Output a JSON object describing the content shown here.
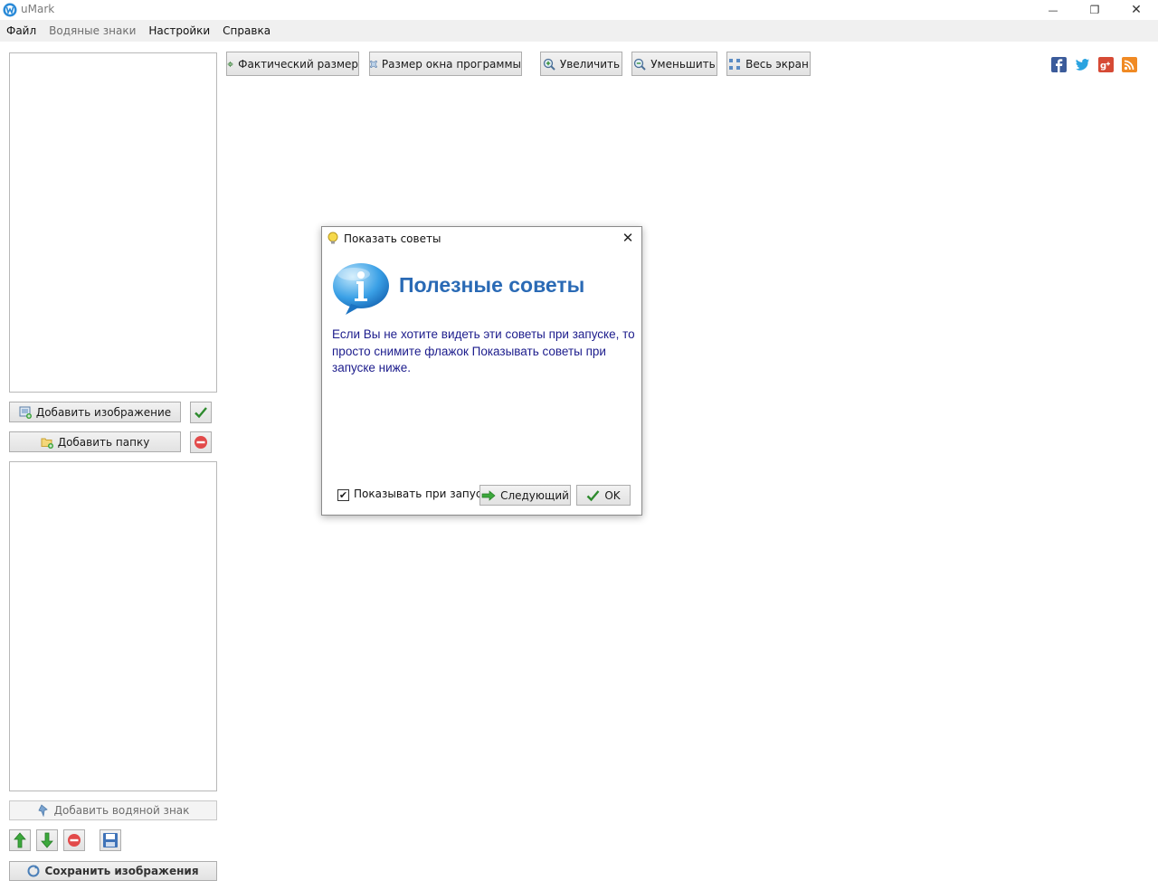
{
  "window": {
    "title": "uMark",
    "minimize_glyph": "—",
    "restore_glyph": "❐",
    "close_glyph": "✕"
  },
  "menu": [
    {
      "label": "Файл",
      "enabled": true
    },
    {
      "label": "Водяные знаки",
      "enabled": false
    },
    {
      "label": "Настройки",
      "enabled": true
    },
    {
      "label": "Справка",
      "enabled": true
    }
  ],
  "left_panel": {
    "add_image_label": "Добавить изображение",
    "add_folder_label": "Добавить папку",
    "add_watermark_label": "Добавить водяной знак",
    "save_images_label": "Сохранить изображения"
  },
  "toolbar": {
    "actual_size": "Фактический размер",
    "window_size": "Размер окна программы",
    "zoom_in": "Увеличить",
    "zoom_out": "Уменьшить",
    "full_screen": "Весь экран"
  },
  "social": [
    "facebook-icon",
    "twitter-icon",
    "google-plus-icon",
    "rss-icon"
  ],
  "dialog": {
    "title": "Показать советы",
    "heading": "Полезные советы",
    "text": "Если Вы не хотите видеть эти советы при запуске, то просто снимите флажок Показывать советы при запуске ниже.",
    "checkbox_label": "Показывать при запуске",
    "checkbox_checked": true,
    "next_label": "Следующий",
    "ok_label": "OK",
    "close_glyph": "✕"
  },
  "colors": {
    "heading": "#2a6ab5",
    "dialog_text": "#1c1c8c",
    "menubar": "#f0f0f0"
  }
}
